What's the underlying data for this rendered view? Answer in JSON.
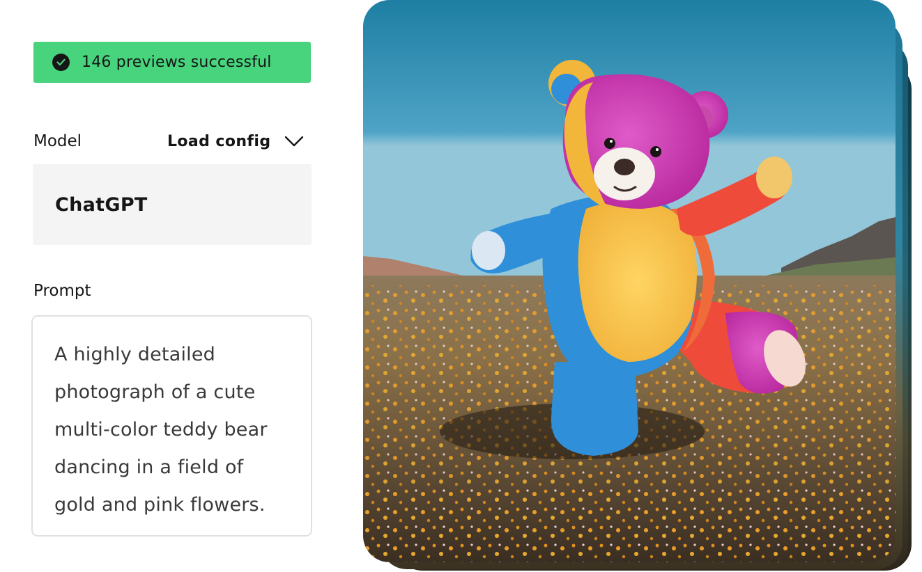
{
  "status": {
    "icon": "check-circle-icon",
    "text": "146 previews successful",
    "color": "#47d47c"
  },
  "model": {
    "label": "Model",
    "load_config_label": "Load config",
    "load_config_icon": "chevron-down-icon",
    "value": "ChatGPT"
  },
  "prompt": {
    "label": "Prompt",
    "lines": [
      "A highly detailed",
      "photograph of a cute",
      "multi-color teddy bear",
      "dancing in a field of",
      "gold and pink flowers."
    ]
  },
  "image": {
    "subject": "teddy-bear-photo"
  }
}
